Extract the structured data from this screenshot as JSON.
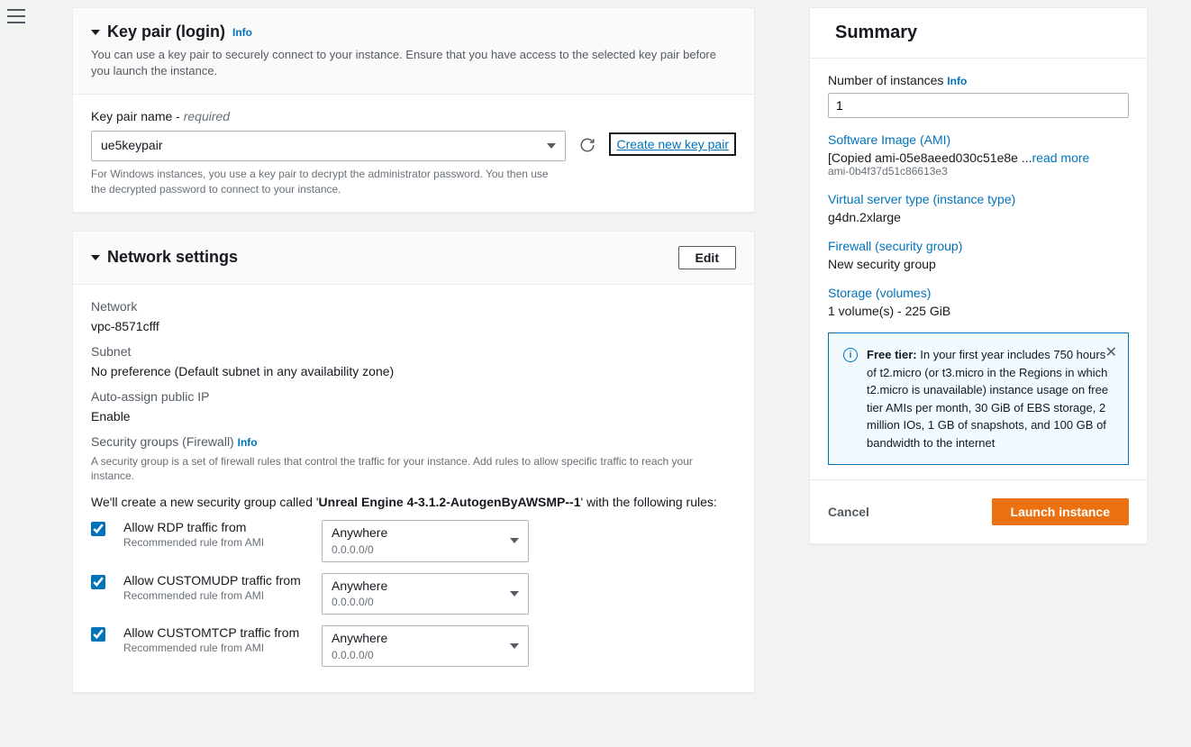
{
  "keypair": {
    "title": "Key pair (login)",
    "info": "Info",
    "desc": "You can use a key pair to securely connect to your instance. Ensure that you have access to the selected key pair before you launch the instance.",
    "field_label": "Key pair name - ",
    "required": "required",
    "value": "ue5keypair",
    "help": "For Windows instances, you use a key pair to decrypt the administrator password. You then use the decrypted password to connect to your instance.",
    "create_link": "Create new key pair"
  },
  "network": {
    "title": "Network settings",
    "edit": "Edit",
    "fields": {
      "network_label": "Network",
      "network_value": "vpc-8571cfff",
      "subnet_label": "Subnet",
      "subnet_value": "No preference (Default subnet in any availability zone)",
      "ip_label": "Auto-assign public IP",
      "ip_value": "Enable",
      "sg_label": "Security groups (Firewall)",
      "sg_info": "Info",
      "sg_desc": "A security group is a set of firewall rules that control the traffic for your instance. Add rules to allow specific traffic to reach your instance.",
      "sg_create_prefix": "We'll create a new security group called '",
      "sg_create_name": "Unreal Engine 4-3.1.2-AutogenByAWSMP--1",
      "sg_create_suffix": "' with the following rules:"
    },
    "rules": [
      {
        "label": "Allow RDP traffic from",
        "recommended": "Recommended rule from AMI",
        "select_main": "Anywhere",
        "select_sub": "0.0.0.0/0"
      },
      {
        "label": "Allow CUSTOMUDP traffic from",
        "recommended": "Recommended rule from AMI",
        "select_main": "Anywhere",
        "select_sub": "0.0.0.0/0"
      },
      {
        "label": "Allow CUSTOMTCP traffic from",
        "recommended": "Recommended rule from AMI",
        "select_main": "Anywhere",
        "select_sub": "0.0.0.0/0"
      }
    ]
  },
  "summary": {
    "title": "Summary",
    "num_instances_label": "Number of instances",
    "num_instances_info": "Info",
    "num_instances_value": "1",
    "ami_label": "Software Image (AMI)",
    "ami_value": "[Copied ami-05e8aeed030c51e8e ...",
    "ami_readmore": "read more",
    "ami_id": "ami-0b4f37d51c86613e3",
    "type_label": "Virtual server type (instance type)",
    "type_value": "g4dn.2xlarge",
    "fw_label": "Firewall (security group)",
    "fw_value": "New security group",
    "storage_label": "Storage (volumes)",
    "storage_value": "1 volume(s) - 225 GiB",
    "free_tier_bold": "Free tier:",
    "free_tier_text": " In your first year includes 750 hours of t2.micro (or t3.micro in the Regions in which t2.micro is unavailable) instance usage on free tier AMIs per month, 30 GiB of EBS storage, 2 million IOs, 1 GB of snapshots, and 100 GB of bandwidth to the internet",
    "cancel": "Cancel",
    "launch": "Launch instance"
  }
}
